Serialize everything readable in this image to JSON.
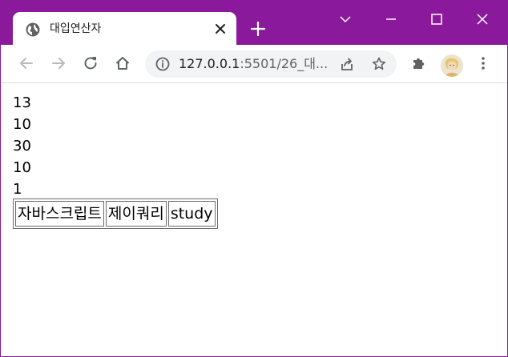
{
  "window": {
    "tab_title": "대입연산자",
    "frame_color": "#8a1a9b"
  },
  "toolbar": {
    "url_host": "127.0.0.1",
    "url_rest": ":5501/26_대..."
  },
  "output": {
    "lines": [
      "13",
      "10",
      "30",
      "10",
      "1"
    ],
    "table_cells": [
      "자바스크립트",
      "제이쿼리",
      "study"
    ]
  },
  "icons": {
    "tab_favicon": "globe-icon",
    "tab_close": "close-icon",
    "new_tab": "plus-icon",
    "tab_search": "chevron-down-icon",
    "minimize": "minimize-icon",
    "maximize": "maximize-icon",
    "close_window": "close-icon",
    "back": "arrow-left-icon",
    "forward": "arrow-right-icon",
    "reload": "reload-icon",
    "home": "home-icon",
    "site_info": "info-icon",
    "share": "share-icon",
    "bookmark": "star-icon",
    "extensions": "puzzle-icon",
    "profile": "avatar",
    "menu": "kebab-menu-icon"
  }
}
